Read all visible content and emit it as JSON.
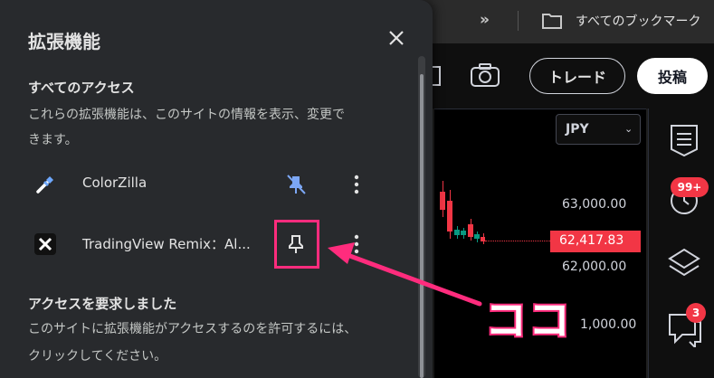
{
  "browser": {
    "bookmarks_label": "すべてのブックマーク"
  },
  "app": {
    "trade_button": "トレード",
    "post_button": "投稿",
    "currency": "JPY",
    "prices": [
      "63,000.00",
      "62,000.00",
      "1,000.00"
    ],
    "current_price": "62,417.83",
    "notif_badge": "99+",
    "chat_badge": "3"
  },
  "popup": {
    "title": "拡張機能",
    "all_access_heading": "すべてのアクセス",
    "all_access_line1": "これらの拡張機能は、このサイトの情報を表示、変更で",
    "all_access_line2": "きます。",
    "extensions": [
      {
        "name": "ColorZilla",
        "pinned": true
      },
      {
        "name": "TradingView Remix：Al...",
        "pinned": false
      }
    ],
    "request_heading": "アクセスを要求しました",
    "request_line1": "このサイトに拡張機能がアクセスするのを許可するには、",
    "request_line2": "クリックしてください。"
  },
  "annotation": {
    "label": "ココ",
    "color": "#ff2c7d"
  }
}
